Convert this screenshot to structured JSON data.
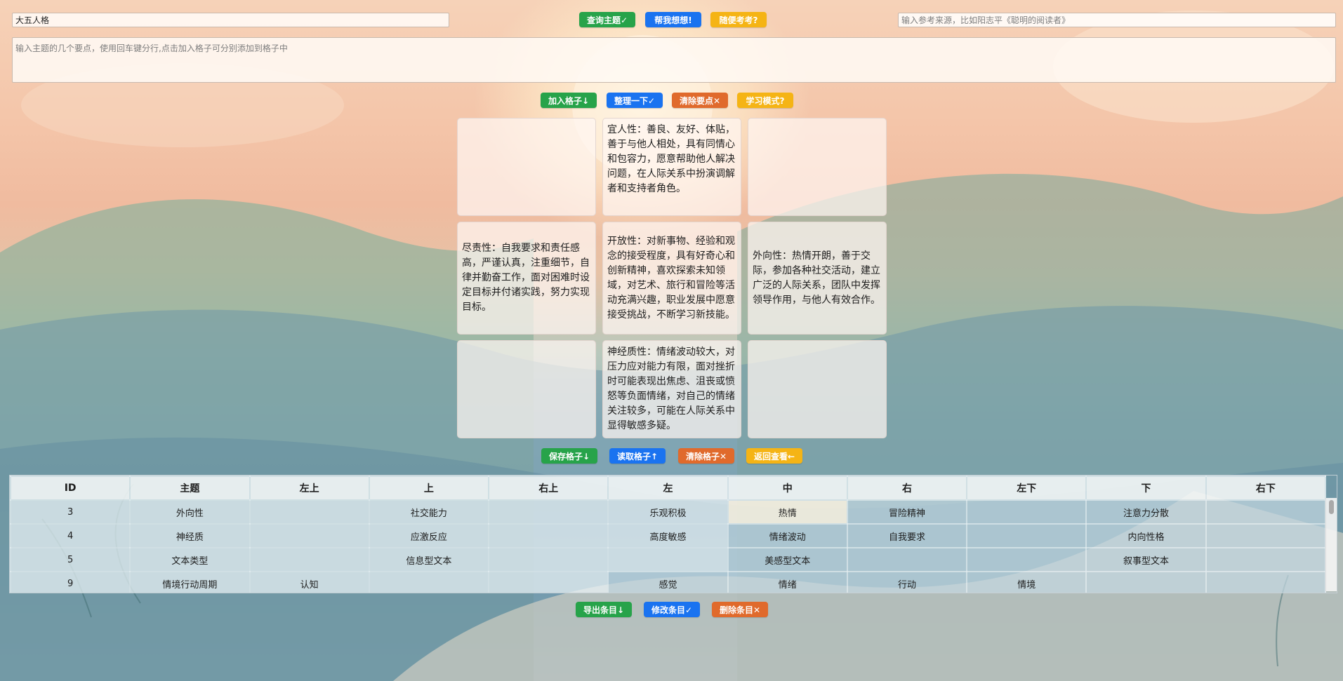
{
  "top": {
    "title_value": "大五人格",
    "query_btn": "查询主题✓",
    "help_btn": "帮我想想!",
    "test_btn": "随便考考?",
    "source_placeholder": "输入参考来源，比如阳志平《聪明的阅读者》"
  },
  "points": {
    "placeholder": "输入主题的几个要点，使用回车键分行,点击加入格子可分别添加到格子中"
  },
  "actions": {
    "add_cells": "加入格子↓",
    "organize": "整理一下✓",
    "clear_points": "清除要点✕",
    "study_mode": "学习模式?"
  },
  "grid": {
    "top_left": "",
    "top": "宜人性：善良、友好、体贴，善于与他人相处，具有同情心和包容力，愿意帮助他人解决问题，在人际关系中扮演调解者和支持者角色。",
    "top_right": "",
    "left": "尽责性：自我要求和责任感高，严谨认真，注重细节，自律并勤奋工作，面对困难时设定目标并付诸实践，努力实现目标。",
    "center": "开放性：对新事物、经验和观念的接受程度，具有好奇心和创新精神，喜欢探索未知领域，对艺术、旅行和冒险等活动充满兴趣，职业发展中愿意接受挑战，不断学习新技能。",
    "right": "外向性：热情开朗，善于交际，参加各种社交活动，建立广泛的人际关系，团队中发挥领导作用，与他人有效合作。",
    "bottom_left": "",
    "bottom": "神经质性：情绪波动较大，对压力应对能力有限，面对挫折时可能表现出焦虑、沮丧或愤怒等负面情绪，对自己的情绪关注较多，可能在人际关系中显得敏感多疑。",
    "bottom_right": ""
  },
  "grid_actions": {
    "save": "保存格子↓",
    "load": "读取格子↑",
    "clear": "清除格子✕",
    "back": "返回查看←"
  },
  "table": {
    "headers": [
      "ID",
      "主题",
      "左上",
      "上",
      "右上",
      "左",
      "中",
      "右",
      "左下",
      "下",
      "右下"
    ],
    "rows": [
      [
        "3",
        "外向性",
        "",
        "社交能力",
        "",
        "乐观积极",
        "热情",
        "冒险精神",
        "",
        "注意力分散",
        ""
      ],
      [
        "4",
        "神经质",
        "",
        "应激反应",
        "",
        "高度敏感",
        "情绪波动",
        "自我要求",
        "",
        "内向性格",
        ""
      ],
      [
        "5",
        "文本类型",
        "",
        "信息型文本",
        "",
        "",
        "美感型文本",
        "",
        "",
        "叙事型文本",
        ""
      ],
      [
        "9",
        "情境行动周期",
        "认知",
        "",
        "",
        "感觉",
        "情绪",
        "行动",
        "情境",
        "",
        ""
      ]
    ]
  },
  "entry_actions": {
    "export": "导出条目↓",
    "modify": "修改条目✓",
    "delete": "删除条目✕"
  },
  "colors": {
    "green": "#27a34a",
    "blue": "#1a73f0",
    "orange": "#e06a2c",
    "yellow": "#f5b415"
  }
}
